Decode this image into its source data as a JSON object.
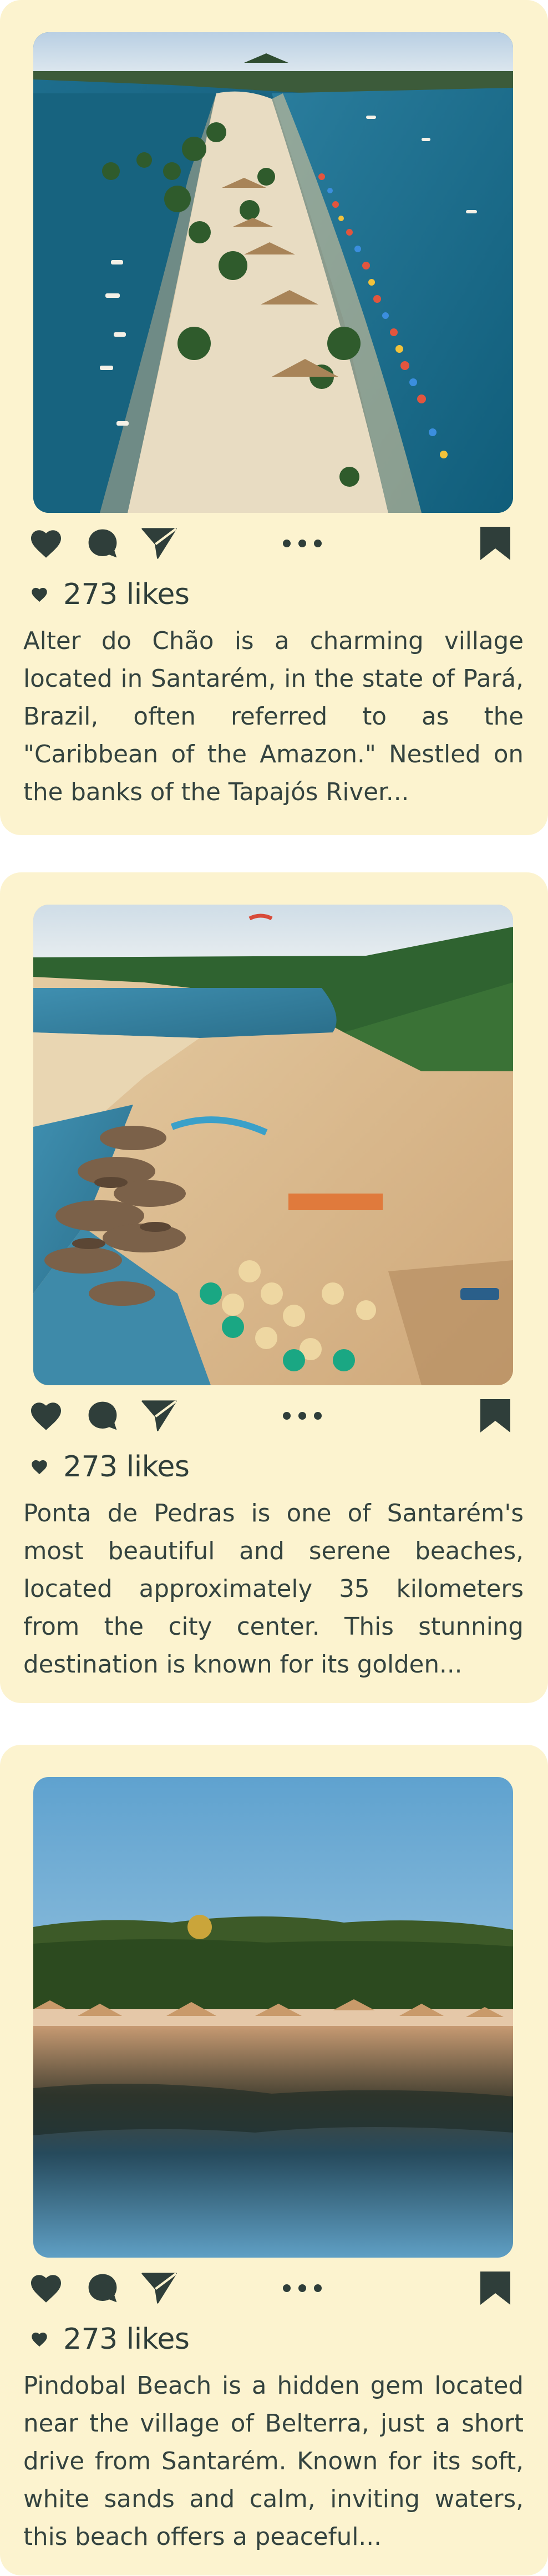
{
  "posts": [
    {
      "image_alt": "Alter do Chão",
      "likes": "273 likes",
      "caption": "Alter do Chão is a charming village located in Santarém, in the state of Pará, Brazil, often referred to as the \"Caribbean of the Amazon.\" Nestled on the banks of the Tapajós River..."
    },
    {
      "image_alt": "Ponta de Pedras",
      "likes": "273 likes",
      "caption": "Ponta de Pedras is one of Santarém's most beautiful and serene beaches, located approximately 35 kilometers from the city center. This stunning destination is known for its golden..."
    },
    {
      "image_alt": "Pindobal Beach",
      "likes": "273 likes",
      "caption": "Pindobal Beach is a hidden gem located near the village of Belterra, just a short drive from Santarém. Known for its soft, white sands and calm, inviting waters, this beach offers a peaceful..."
    }
  ],
  "icons": {
    "like": "heart-icon",
    "comment": "comment-icon",
    "share": "send-icon",
    "more": "more-dots-icon",
    "save": "bookmark-icon"
  },
  "colors": {
    "card_background": "#fcf3cf",
    "icon": "#2f3e3a",
    "text": "#34433f"
  }
}
